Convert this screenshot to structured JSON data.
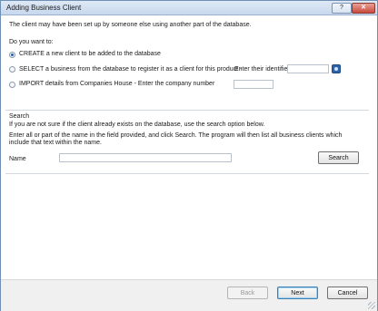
{
  "window": {
    "title": "Adding Business Client",
    "help_label": "?",
    "close_label": "✕"
  },
  "intro": "The client may have been set up by someone else using another part of the database.",
  "question": "Do you want to:",
  "options": {
    "create": {
      "label": "CREATE a new client to be added to the database",
      "selected": true
    },
    "select": {
      "label": "SELECT a business from the database to register it as a client for this product -",
      "identifier_label": "Enter their identifier",
      "identifier_value": "",
      "selected": false
    },
    "import": {
      "label": "IMPORT details from Companies House - Enter the company number",
      "company_number_value": "",
      "selected": false
    }
  },
  "search": {
    "heading": "Search",
    "line1": "If you are not sure if the client already exists on the database, use the search option below.",
    "line2": "Enter all or part of the name in the field provided, and click Search. The program will then list all business clients which",
    "line3": "include that text within the name.",
    "name_label": "Name",
    "name_value": "",
    "button": "Search"
  },
  "buttons": {
    "back": "Back",
    "next": "Next",
    "cancel": "Cancel"
  },
  "icons": {
    "go": "search-go-icon",
    "resize": "resize-grip-icon"
  }
}
